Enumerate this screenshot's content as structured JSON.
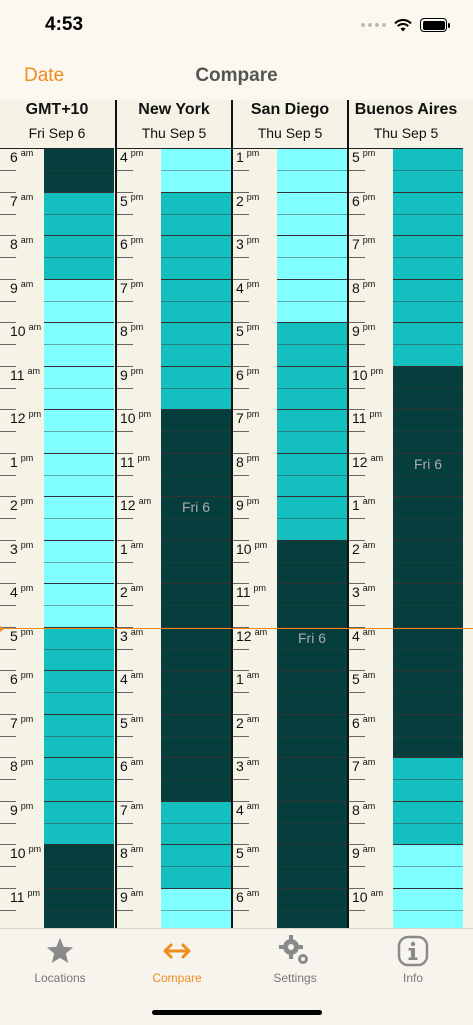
{
  "status_bar": {
    "time": "4:53"
  },
  "nav": {
    "back_label": "Date",
    "title": "Compare"
  },
  "colors": {
    "accent": "#f08c1e",
    "dark": "#063d3d",
    "mid": "#14bfbf",
    "light": "#7fffff"
  },
  "columns": [
    {
      "name": "GMT+10",
      "date": "Fri Sep 6",
      "hours": [
        [
          "6",
          "am"
        ],
        [
          "7",
          "am"
        ],
        [
          "8",
          "am"
        ],
        [
          "9",
          "am"
        ],
        [
          "10",
          "am"
        ],
        [
          "11",
          "am"
        ],
        [
          "12",
          "pm"
        ],
        [
          "1",
          "pm"
        ],
        [
          "2",
          "pm"
        ],
        [
          "3",
          "pm"
        ],
        [
          "4",
          "pm"
        ],
        [
          "5",
          "pm"
        ],
        [
          "6",
          "pm"
        ],
        [
          "7",
          "pm"
        ],
        [
          "8",
          "pm"
        ],
        [
          "9",
          "pm"
        ],
        [
          "10",
          "pm"
        ],
        [
          "11",
          "pm"
        ]
      ],
      "shades": [
        "dark",
        "mid",
        "mid",
        "light",
        "light",
        "light",
        "light",
        "light",
        "light",
        "light",
        "light",
        "mid",
        "mid",
        "mid",
        "mid",
        "mid",
        "dark",
        "dark"
      ],
      "day_label": "",
      "day_label_row": -1
    },
    {
      "name": "New York",
      "date": "Thu Sep 5",
      "hours": [
        [
          "4",
          "pm"
        ],
        [
          "5",
          "pm"
        ],
        [
          "6",
          "pm"
        ],
        [
          "7",
          "pm"
        ],
        [
          "8",
          "pm"
        ],
        [
          "9",
          "pm"
        ],
        [
          "10",
          "pm"
        ],
        [
          "11",
          "pm"
        ],
        [
          "12",
          "am"
        ],
        [
          "1",
          "am"
        ],
        [
          "2",
          "am"
        ],
        [
          "3",
          "am"
        ],
        [
          "4",
          "am"
        ],
        [
          "5",
          "am"
        ],
        [
          "6",
          "am"
        ],
        [
          "7",
          "am"
        ],
        [
          "8",
          "am"
        ],
        [
          "9",
          "am"
        ]
      ],
      "shades": [
        "light",
        "mid",
        "mid",
        "mid",
        "mid",
        "mid",
        "dark",
        "dark",
        "dark",
        "dark",
        "dark",
        "dark",
        "dark",
        "dark",
        "dark",
        "mid",
        "mid",
        "light"
      ],
      "day_label": "Fri 6",
      "day_label_row": 8
    },
    {
      "name": "San Diego",
      "date": "Thu Sep 5",
      "hours": [
        [
          "1",
          "pm"
        ],
        [
          "2",
          "pm"
        ],
        [
          "3",
          "pm"
        ],
        [
          "4",
          "pm"
        ],
        [
          "5",
          "pm"
        ],
        [
          "6",
          "pm"
        ],
        [
          "7",
          "pm"
        ],
        [
          "8",
          "pm"
        ],
        [
          "9",
          "pm"
        ],
        [
          "10",
          "pm"
        ],
        [
          "11",
          "pm"
        ],
        [
          "12",
          "am"
        ],
        [
          "1",
          "am"
        ],
        [
          "2",
          "am"
        ],
        [
          "3",
          "am"
        ],
        [
          "4",
          "am"
        ],
        [
          "5",
          "am"
        ],
        [
          "6",
          "am"
        ]
      ],
      "shades": [
        "light",
        "light",
        "light",
        "light",
        "mid",
        "mid",
        "mid",
        "mid",
        "mid",
        "dark",
        "dark",
        "dark",
        "dark",
        "dark",
        "dark",
        "dark",
        "dark",
        "dark"
      ],
      "day_label": "Fri 6",
      "day_label_row": 11
    },
    {
      "name": "Buenos Aires",
      "date": "Thu Sep 5",
      "hours": [
        [
          "5",
          "pm"
        ],
        [
          "6",
          "pm"
        ],
        [
          "7",
          "pm"
        ],
        [
          "8",
          "pm"
        ],
        [
          "9",
          "pm"
        ],
        [
          "10",
          "pm"
        ],
        [
          "11",
          "pm"
        ],
        [
          "12",
          "am"
        ],
        [
          "1",
          "am"
        ],
        [
          "2",
          "am"
        ],
        [
          "3",
          "am"
        ],
        [
          "4",
          "am"
        ],
        [
          "5",
          "am"
        ],
        [
          "6",
          "am"
        ],
        [
          "7",
          "am"
        ],
        [
          "8",
          "am"
        ],
        [
          "9",
          "am"
        ],
        [
          "10",
          "am"
        ]
      ],
      "shades": [
        "mid",
        "mid",
        "mid",
        "mid",
        "mid",
        "dark",
        "dark",
        "dark",
        "dark",
        "dark",
        "dark",
        "dark",
        "dark",
        "dark",
        "mid",
        "mid",
        "light",
        "light"
      ],
      "day_label": "Fri 6",
      "day_label_row": 7
    }
  ],
  "tabs": [
    {
      "label": "Locations",
      "icon": "star-icon",
      "active": false
    },
    {
      "label": "Compare",
      "icon": "arrows-icon",
      "active": true
    },
    {
      "label": "Settings",
      "icon": "gears-icon",
      "active": false
    },
    {
      "label": "Info",
      "icon": "info-icon",
      "active": false
    }
  ]
}
